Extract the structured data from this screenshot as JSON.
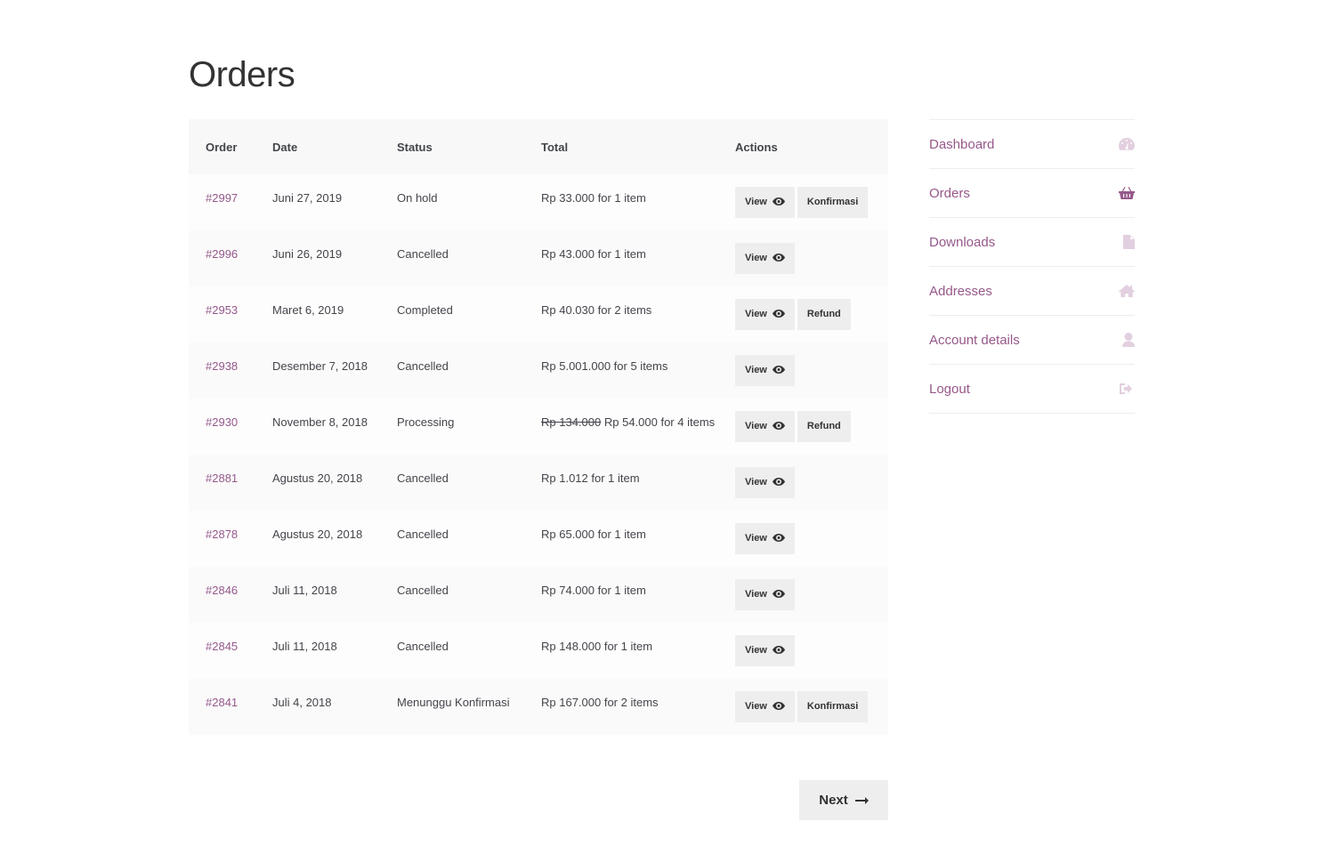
{
  "page": {
    "title": "Orders"
  },
  "table": {
    "headers": {
      "order": "Order",
      "date": "Date",
      "status": "Status",
      "total": "Total",
      "actions": "Actions"
    },
    "rows": [
      {
        "number": "#2997",
        "date": "Juni 27, 2019",
        "status": "On hold",
        "total_old": "",
        "total": "Rp 33.000 for 1 item",
        "view": "View",
        "extra": "Konfirmasi"
      },
      {
        "number": "#2996",
        "date": "Juni 26, 2019",
        "status": "Cancelled",
        "total_old": "",
        "total": "Rp 43.000 for 1 item",
        "view": "View",
        "extra": ""
      },
      {
        "number": "#2953",
        "date": "Maret 6, 2019",
        "status": "Completed",
        "total_old": "",
        "total": "Rp 40.030 for 2 items",
        "view": "View",
        "extra": "Refund"
      },
      {
        "number": "#2938",
        "date": "Desember 7, 2018",
        "status": "Cancelled",
        "total_old": "",
        "total": "Rp 5.001.000 for 5 items",
        "view": "View",
        "extra": ""
      },
      {
        "number": "#2930",
        "date": "November 8, 2018",
        "status": "Processing",
        "total_old": "Rp 134.000",
        "total": "Rp 54.000 for 4 items",
        "view": "View",
        "extra": "Refund"
      },
      {
        "number": "#2881",
        "date": "Agustus 20, 2018",
        "status": "Cancelled",
        "total_old": "",
        "total": "Rp 1.012 for 1 item",
        "view": "View",
        "extra": ""
      },
      {
        "number": "#2878",
        "date": "Agustus 20, 2018",
        "status": "Cancelled",
        "total_old": "",
        "total": "Rp 65.000 for 1 item",
        "view": "View",
        "extra": ""
      },
      {
        "number": "#2846",
        "date": "Juli 11, 2018",
        "status": "Cancelled",
        "total_old": "",
        "total": "Rp 74.000 for 1 item",
        "view": "View",
        "extra": ""
      },
      {
        "number": "#2845",
        "date": "Juli 11, 2018",
        "status": "Cancelled",
        "total_old": "",
        "total": "Rp 148.000 for 1 item",
        "view": "View",
        "extra": ""
      },
      {
        "number": "#2841",
        "date": "Juli 4, 2018",
        "status": "Menunggu Konfirmasi",
        "total_old": "",
        "total": "Rp 167.000 for 2 items",
        "view": "View",
        "extra": "Konfirmasi"
      }
    ]
  },
  "pagination": {
    "next_label": "Next"
  },
  "nav": {
    "items": [
      {
        "label": "Dashboard",
        "icon": "dashboard-icon",
        "active": false
      },
      {
        "label": "Orders",
        "icon": "basket-icon",
        "active": true
      },
      {
        "label": "Downloads",
        "icon": "file-icon",
        "active": false
      },
      {
        "label": "Addresses",
        "icon": "home-icon",
        "active": false
      },
      {
        "label": "Account details",
        "icon": "user-icon",
        "active": false
      },
      {
        "label": "Logout",
        "icon": "sign-out-icon",
        "active": false
      }
    ]
  },
  "colors": {
    "accent": "#96588a",
    "icon_muted": "#e2cfdf",
    "button_bg": "#eeeeee",
    "header_bg": "#f8f8f8"
  }
}
